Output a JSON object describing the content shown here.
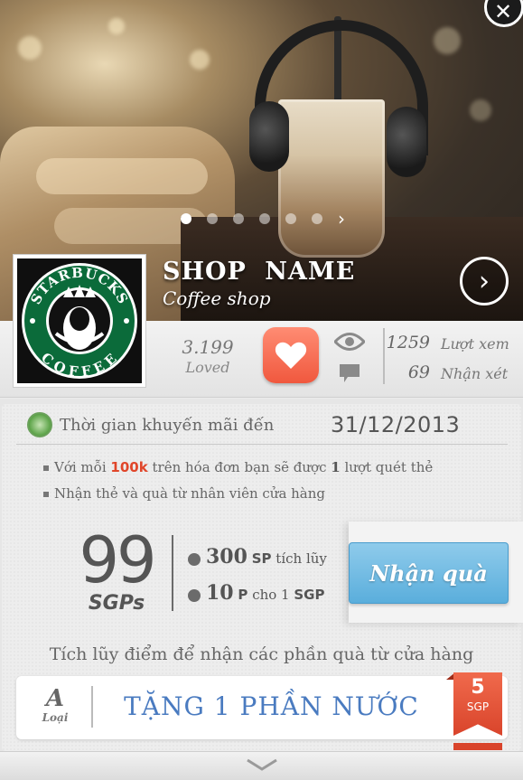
{
  "hero": {
    "slides_total": 6,
    "active_slide": 1,
    "shop_name": "SHOP   NAME",
    "shop_type": "Coffee shop"
  },
  "logo": {
    "top_text": "STARBUCKS",
    "bottom_text": "COFFEE",
    "brand_color": "#0b6b3a"
  },
  "stats": {
    "loved_count": "3.199",
    "loved_label": "Loved",
    "views_count": "1259",
    "views_label": "Lượt xem",
    "comments_count": "69",
    "comments_label": "Nhận xét"
  },
  "promo": {
    "label": "Thời gian khuyến mãi đến",
    "date": "31/12/2013",
    "bullet1_pre": "Với mỗi",
    "bullet1_amount": "100k",
    "bullet1_mid": "trên hóa đơn bạn sẽ được",
    "bullet1_count": "1",
    "bullet1_post": "lượt quét thẻ",
    "bullet2": "Nhận thẻ và quà từ nhân viên cửa hàng"
  },
  "points": {
    "value": "99",
    "unit": "SGPs",
    "rule1_value": "300",
    "rule1_unit": "SP",
    "rule1_text": "tích lũy",
    "rule2_value": "10",
    "rule2_unit": "P",
    "rule2_text": "cho 1",
    "rule2_target": "SGP",
    "claim_label": "Nhận quà"
  },
  "accumulate_text": "Tích lũy điểm để nhận các phần quà từ cửa hàng",
  "gift": {
    "type": "A",
    "type_label": "Loại",
    "name": "TẶNG 1 PHẦN NƯỚC",
    "cost": "5",
    "cost_unit": "SGP"
  },
  "colors": {
    "accent_red": "#f0583e",
    "accent_blue": "#5aaedc",
    "gift_text": "#4a7bc0"
  }
}
